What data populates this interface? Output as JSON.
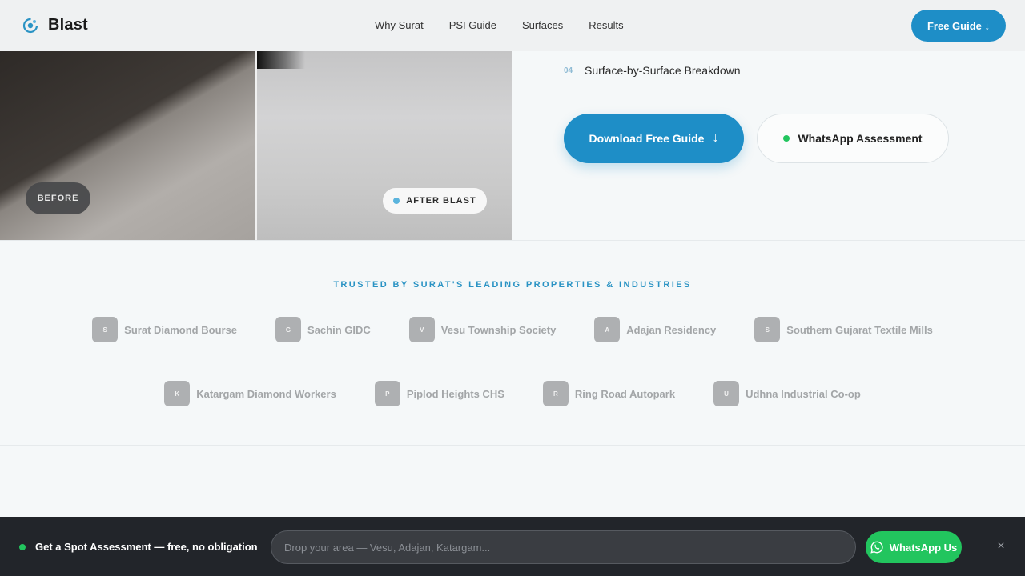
{
  "header": {
    "brand": "Blast",
    "nav": [
      "Why Surat",
      "PSI Guide",
      "Surfaces",
      "Results"
    ],
    "cta": "Free Guide ↓"
  },
  "hero": {
    "before_label": "BEFORE",
    "after_label": "AFTER BLAST",
    "feature": {
      "num": "04",
      "text": "Surface-by-Surface Breakdown"
    },
    "download_btn": "Download Free Guide",
    "download_arrow": "↓",
    "whatsapp_btn": "WhatsApp Assessment"
  },
  "trusted": {
    "title": "TRUSTED BY SURAT'S LEADING PROPERTIES & INDUSTRIES",
    "row1": [
      {
        "initial": "S",
        "name": "Surat Diamond Bourse"
      },
      {
        "initial": "G",
        "name": "Sachin GIDC"
      },
      {
        "initial": "V",
        "name": "Vesu Township Society"
      },
      {
        "initial": "A",
        "name": "Adajan Residency"
      },
      {
        "initial": "S",
        "name": "Southern Gujarat Textile Mills"
      }
    ],
    "row2": [
      {
        "initial": "K",
        "name": "Katargam Diamond Workers"
      },
      {
        "initial": "P",
        "name": "Piplod Heights CHS"
      },
      {
        "initial": "R",
        "name": "Ring Road Autopark"
      },
      {
        "initial": "U",
        "name": "Udhna Industrial Co-op"
      }
    ]
  },
  "bottom_bar": {
    "label": "Get a Spot Assessment — free, no obligation",
    "input_placeholder": "Drop your area — Vesu, Adajan, Katargam...",
    "input_value": "",
    "whatsapp_btn": "WhatsApp Us",
    "close": "×"
  },
  "colors": {
    "accent": "#1e8ec7",
    "whatsapp": "#22c55e",
    "dark_bar": "#22252a"
  },
  "icons": {
    "brand": "water-drop-icon",
    "whatsapp": "whatsapp-icon",
    "close": "close-icon"
  }
}
